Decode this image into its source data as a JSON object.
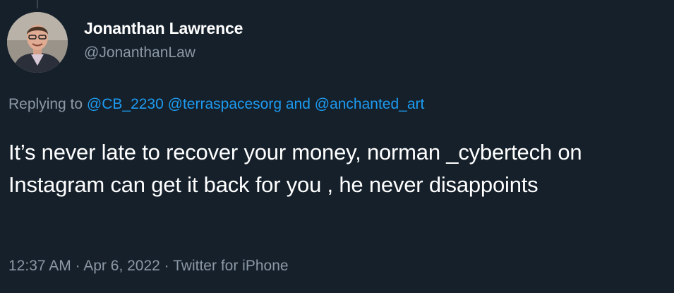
{
  "tweet": {
    "author": {
      "display_name": "Jonanthan Lawrence",
      "handle": "@JonanthanLaw"
    },
    "reply": {
      "prefix": "Replying to ",
      "mention_1": "@CB_2230",
      "mention_2": "@terraspacesorg",
      "conjunction": " and ",
      "mention_3": "@anchanted_art"
    },
    "text": "It’s never late to recover your money, norman _cybertech on Instagram can get it back for you , he never disappoints",
    "time": "12:37 AM",
    "separator": " · ",
    "date": "Apr 6, 2022",
    "source": "Twitter for iPhone"
  },
  "colors": {
    "background": "#15202b",
    "secondary_text": "#8b98a5",
    "link": "#1d9bf0"
  }
}
